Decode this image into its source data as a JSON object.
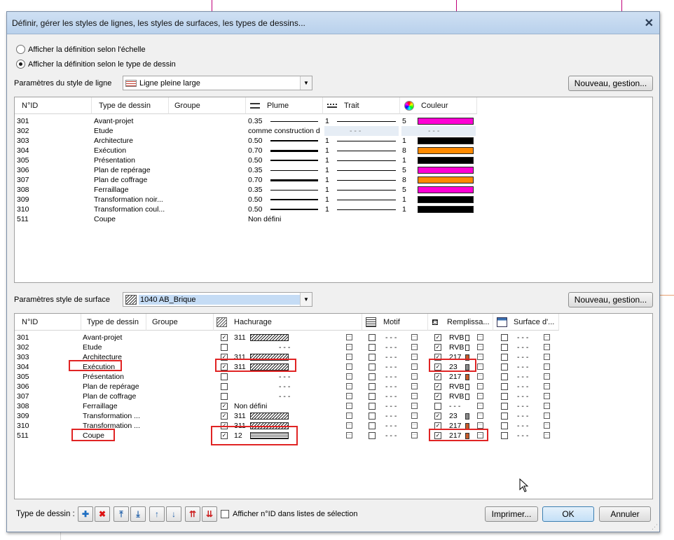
{
  "window": {
    "title": "Définir, gérer les styles de lignes, les styles de surfaces, les types de dessins..."
  },
  "radios": [
    {
      "label": "Afficher la définition selon l'échelle",
      "selected": false
    },
    {
      "label": "Afficher la définition selon le type de dessin",
      "selected": true
    }
  ],
  "line_style": {
    "label": "Paramètres du style de ligne",
    "combo_value": "Ligne pleine large",
    "new_button": "Nouveau, gestion...",
    "columns": [
      "N°ID",
      "Type de dessin",
      "Groupe",
      "Plume",
      "Trait",
      "Couleur"
    ],
    "rows": [
      {
        "id": "301",
        "type": "Avant-projet",
        "pen": "0.35",
        "trait": "1",
        "color_no": "5",
        "color": "#ff00d4",
        "weight": 1
      },
      {
        "id": "302",
        "type": "Etude",
        "pen": "comme construction d",
        "trait": "- - -",
        "color_no": "- - -",
        "color": "",
        "weight": 0
      },
      {
        "id": "303",
        "type": "Architecture",
        "pen": "0.50",
        "trait": "1",
        "color_no": "1",
        "color": "#000000",
        "weight": 2
      },
      {
        "id": "304",
        "type": "Exécution",
        "pen": "0.70",
        "trait": "1",
        "color_no": "8",
        "color": "#ff8a00",
        "weight": 3
      },
      {
        "id": "305",
        "type": "Présentation",
        "pen": "0.50",
        "trait": "1",
        "color_no": "1",
        "color": "#000000",
        "weight": 2
      },
      {
        "id": "306",
        "type": "Plan de repérage",
        "pen": "0.35",
        "trait": "1",
        "color_no": "5",
        "color": "#ff00d4",
        "weight": 1
      },
      {
        "id": "307",
        "type": "Plan de coffrage",
        "pen": "0.70",
        "trait": "1",
        "color_no": "8",
        "color": "#ff8a00",
        "weight": 3
      },
      {
        "id": "308",
        "type": "Ferraillage",
        "pen": "0.35",
        "trait": "1",
        "color_no": "5",
        "color": "#ff00d4",
        "weight": 1
      },
      {
        "id": "309",
        "type": "Transformation noir...",
        "pen": "0.50",
        "trait": "1",
        "color_no": "1",
        "color": "#000000",
        "weight": 2
      },
      {
        "id": "310",
        "type": "Transformation coul...",
        "pen": "0.50",
        "trait": "1",
        "color_no": "1",
        "color": "#000000",
        "weight": 2
      },
      {
        "id": "511",
        "type": "Coupe",
        "pen": "Non défini",
        "trait": "",
        "color_no": "",
        "color": "",
        "weight": 0
      }
    ]
  },
  "surface_style": {
    "label": "Paramètres style de surface",
    "combo_value": "1040 AB_Brique",
    "new_button": "Nouveau, gestion...",
    "columns": [
      "N°ID",
      "Type de dessin",
      "Groupe",
      "Hachurage",
      "Motif",
      "Remplissa...",
      "Surface d'..."
    ],
    "rows": [
      {
        "id": "301",
        "type": "Avant-projet",
        "hatch_on": true,
        "hatch": "311",
        "hatch_kind": "diag",
        "fill_on": true,
        "fill": "RVB",
        "fill_color": "#ffffff"
      },
      {
        "id": "302",
        "type": "Etude",
        "hatch_on": false,
        "hatch": "- - -",
        "hatch_kind": "",
        "fill_on": true,
        "fill": "RVB",
        "fill_color": "#ffffff"
      },
      {
        "id": "303",
        "type": "Architecture",
        "hatch_on": true,
        "hatch": "311",
        "hatch_kind": "diag",
        "fill_on": true,
        "fill": "217",
        "fill_color": "#c85a2a"
      },
      {
        "id": "304",
        "type": "Exécution",
        "hatch_on": true,
        "hatch": "311",
        "hatch_kind": "diag",
        "fill_on": true,
        "fill": "23",
        "fill_color": "#8a8a8a"
      },
      {
        "id": "305",
        "type": "Présentation",
        "hatch_on": false,
        "hatch": "- - -",
        "hatch_kind": "",
        "fill_on": true,
        "fill": "217",
        "fill_color": "#c85a2a"
      },
      {
        "id": "306",
        "type": "Plan de repérage",
        "hatch_on": false,
        "hatch": "- - -",
        "hatch_kind": "",
        "fill_on": true,
        "fill": "RVB",
        "fill_color": "#ffffff"
      },
      {
        "id": "307",
        "type": "Plan de coffrage",
        "hatch_on": false,
        "hatch": "- - -",
        "hatch_kind": "",
        "fill_on": true,
        "fill": "RVB",
        "fill_color": "#ffffff"
      },
      {
        "id": "308",
        "type": "Ferraillage",
        "hatch_on": true,
        "hatch": "Non défini",
        "hatch_kind": "",
        "fill_on": false,
        "fill": "- - -",
        "fill_color": ""
      },
      {
        "id": "309",
        "type": "Transformation ...",
        "hatch_on": true,
        "hatch": "311",
        "hatch_kind": "diag",
        "fill_on": true,
        "fill": "23",
        "fill_color": "#8a8a8a"
      },
      {
        "id": "310",
        "type": "Transformation ...",
        "hatch_on": true,
        "hatch": "311",
        "hatch_kind": "diag",
        "fill_on": true,
        "fill": "217",
        "fill_color": "#c85a2a"
      },
      {
        "id": "511",
        "type": "Coupe",
        "hatch_on": true,
        "hatch": "12",
        "hatch_kind": "horiz",
        "fill_on": true,
        "fill": "217",
        "fill_color": "#c85a2a"
      }
    ],
    "dash": "- - -"
  },
  "footer": {
    "type_label": "Type de dessin :",
    "checkbox_label": "Afficher n°ID dans listes de sélection",
    "print_button": "Imprimer...",
    "ok_button": "OK",
    "cancel_button": "Annuler"
  }
}
